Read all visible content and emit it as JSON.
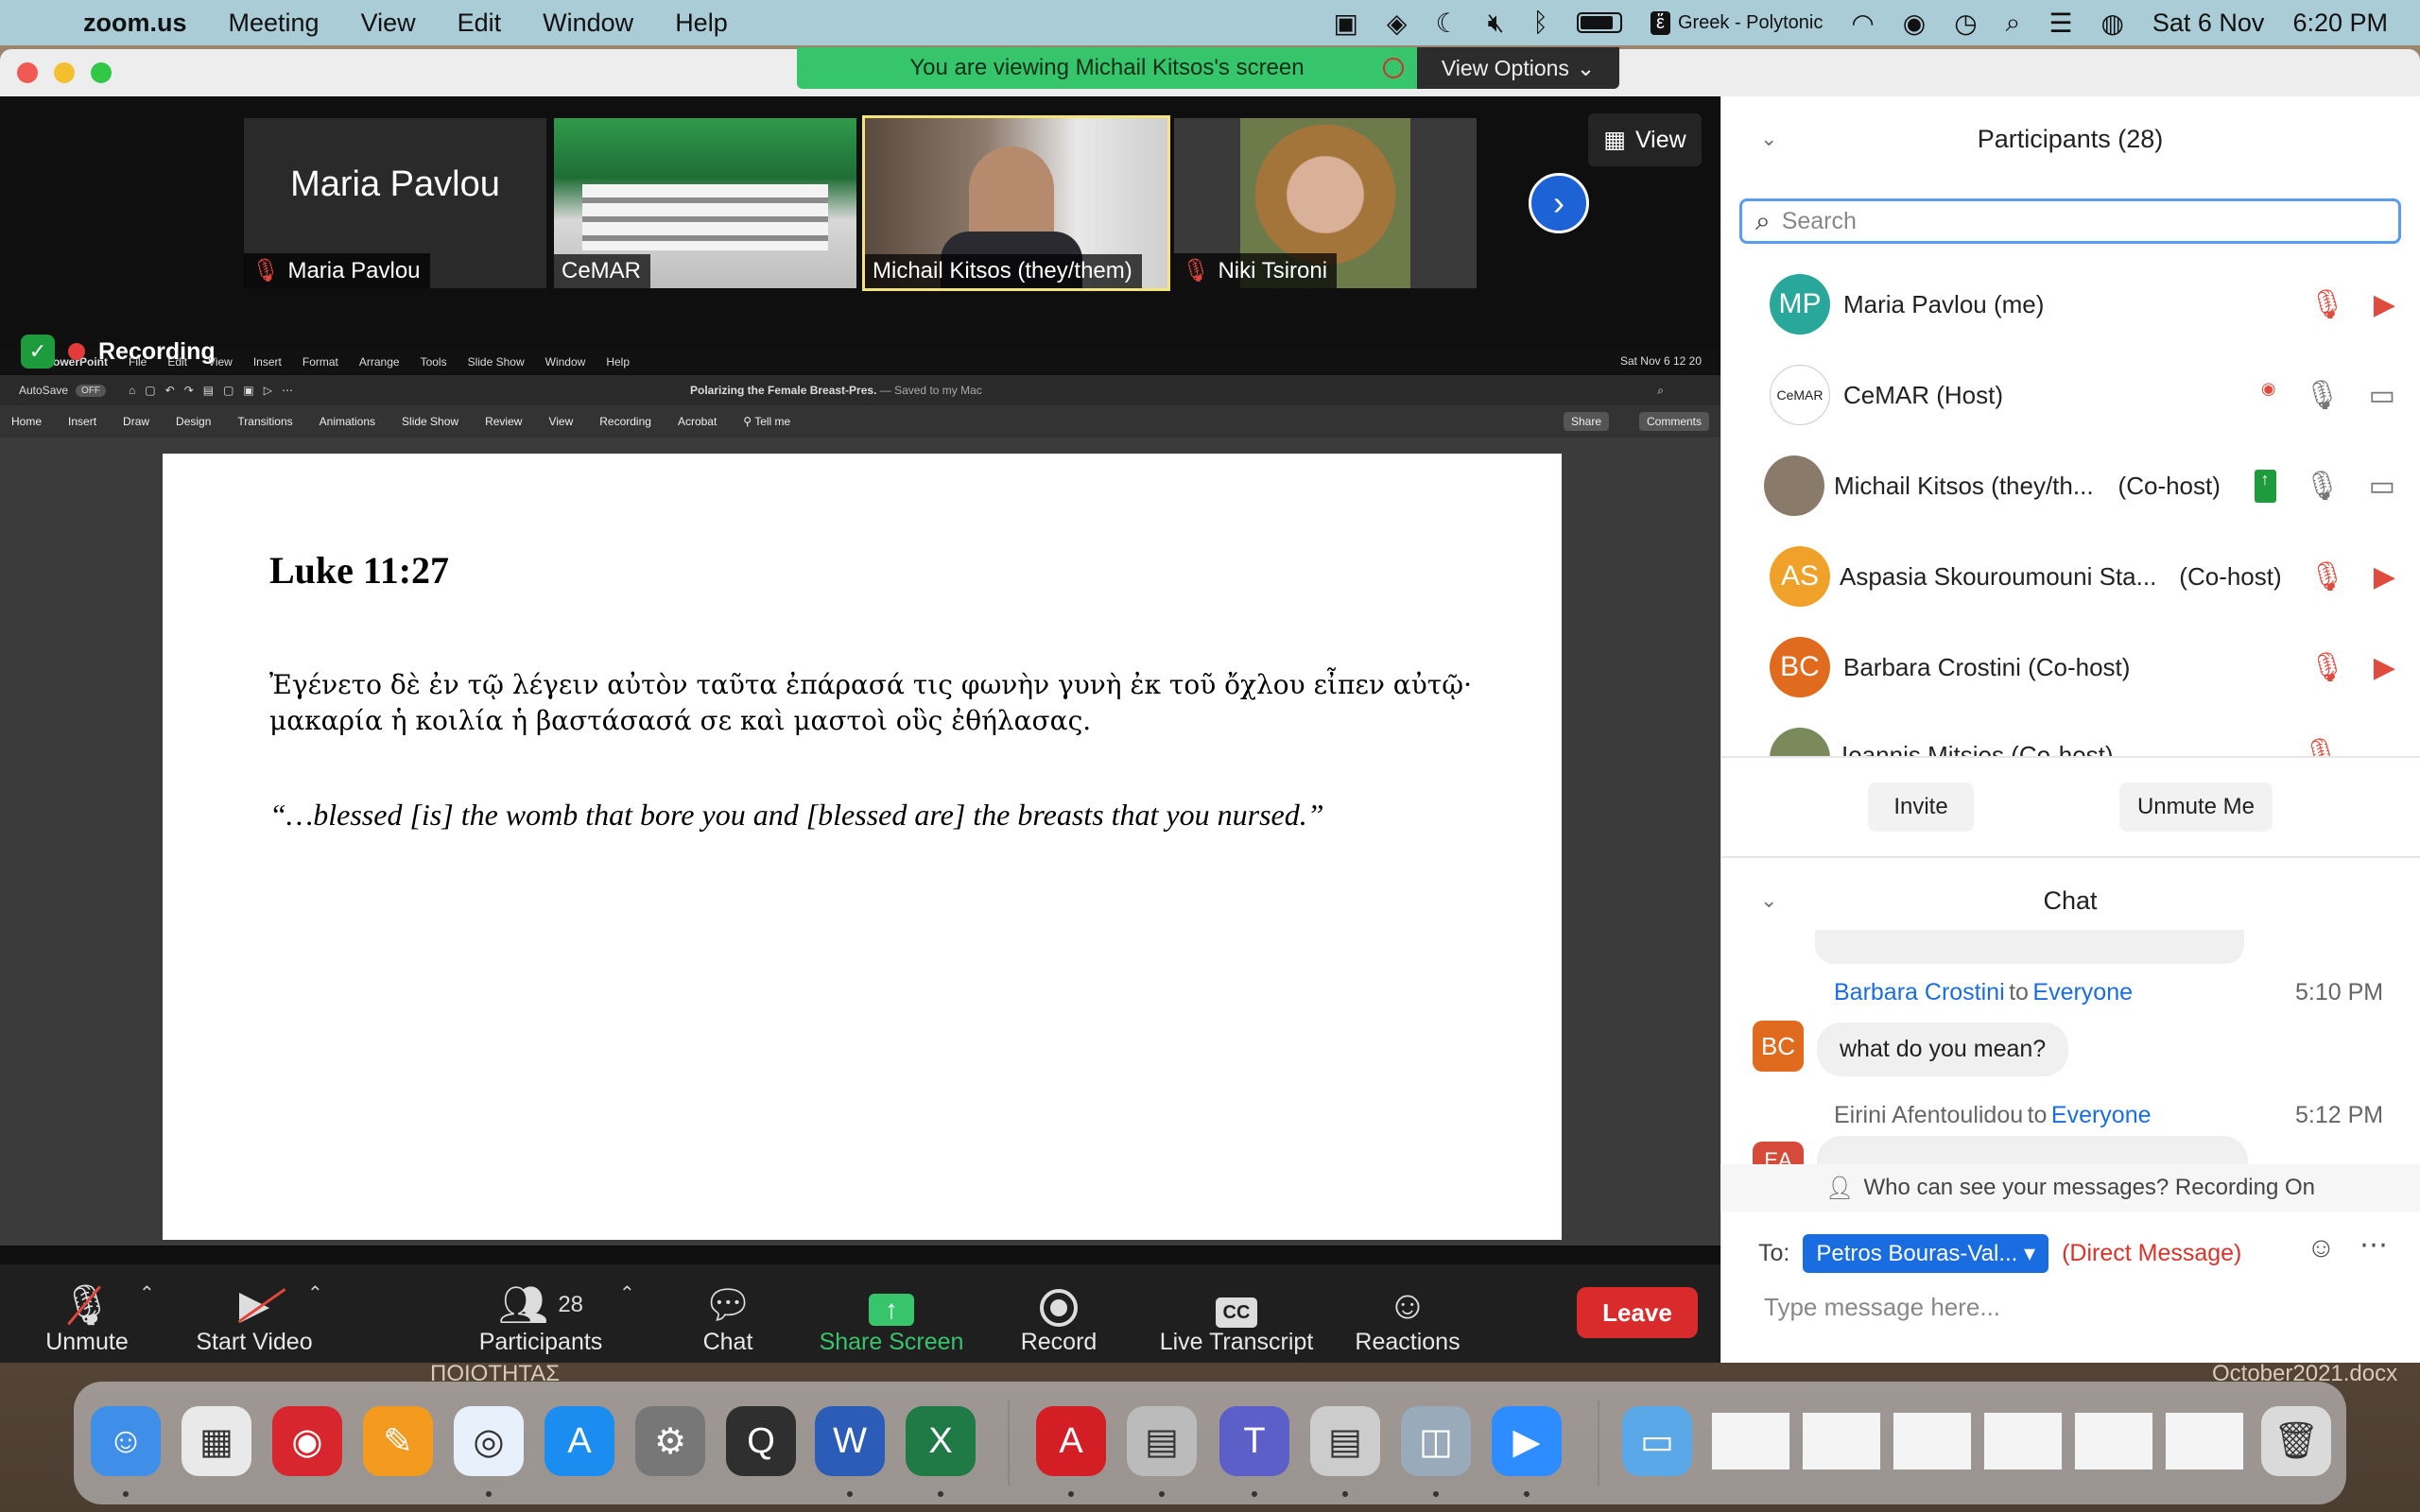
{
  "menubar": {
    "app": "zoom.us",
    "items": [
      "Meeting",
      "View",
      "Edit",
      "Window",
      "Help"
    ],
    "keyboard": "Greek - Polytonic",
    "date": "Sat 6 Nov",
    "time": "6:20 PM"
  },
  "banner": {
    "text": "You are viewing Michail Kitsos's screen",
    "view_options": "View Options"
  },
  "gallery": {
    "view_label": "View",
    "tiles": [
      {
        "label": "Maria Pavlou",
        "big_name": "Maria Pavlou",
        "muted": true
      },
      {
        "label": "CeMAR",
        "muted": false
      },
      {
        "label": "Michail Kitsos  (they/them)",
        "muted": false
      },
      {
        "label": "Niki Tsironi",
        "muted": true
      }
    ]
  },
  "recording_label": "Recording",
  "ppt": {
    "menubar": [
      "PowerPoint",
      "File",
      "Edit",
      "View",
      "Insert",
      "Format",
      "Arrange",
      "Tools",
      "Slide Show",
      "Window",
      "Help"
    ],
    "menubar_right": "Sat Nov 6  12 20",
    "autosave": "AutoSave",
    "autosave_state": "OFF",
    "title": "Polarizing the Female Breast-Pres.",
    "saved": "— Saved to my Mac",
    "ribbon": [
      "Home",
      "Insert",
      "Draw",
      "Design",
      "Transitions",
      "Animations",
      "Slide Show",
      "Review",
      "View",
      "Recording",
      "Acrobat",
      "Tell me"
    ],
    "share": "Share",
    "comments": "Comments"
  },
  "slide": {
    "title": "Luke 11:27",
    "greek": "Ἐγένετο δὲ ἐν τῷ λέγειν αὐτὸν ταῦτα ἐπάρασά τις φωνὴν γυνὴ ἐκ τοῦ ὄχλου εἶπεν αὐτῷ· μακαρία ἡ κοιλία ἡ βαστάσασά σε καὶ μαστοὶ οὓς ἐθήλασας.",
    "english": "“…blessed [is] the womb that bore you and [blessed are] the breasts that you nursed.”"
  },
  "toolbar": {
    "unmute": "Unmute",
    "start_video": "Start Video",
    "participants": "Participants",
    "participant_count": "28",
    "chat": "Chat",
    "share_screen": "Share Screen",
    "record": "Record",
    "live_transcript": "Live Transcript",
    "cc": "CC",
    "reactions": "Reactions",
    "leave": "Leave"
  },
  "participants": {
    "title": "Participants (28)",
    "search_placeholder": "Search",
    "list": [
      {
        "initials": "MP",
        "name": "Maria Pavlou (me)",
        "color": "#2aa79b"
      },
      {
        "initials": "",
        "name": "CeMAR (Host)",
        "color": "#ffffff"
      },
      {
        "initials": "",
        "name": "Michail Kitsos (they/th...",
        "role": "(Co-host)",
        "color": "#8a7a6a"
      },
      {
        "initials": "AS",
        "name": "Aspasia Skouroumouni Sta...",
        "role": "(Co-host)",
        "color": "#f0a12a"
      },
      {
        "initials": "BC",
        "name": "Barbara Crostini (Co-host)",
        "color": "#e06a1e"
      },
      {
        "initials": "",
        "name": "Ioannis Mitsios (Co-host)",
        "color": "#7a8a5a"
      }
    ],
    "invite": "Invite",
    "unmute_me": "Unmute Me"
  },
  "chat": {
    "title": "Chat",
    "messages": [
      {
        "initials": "BC",
        "from": "Barbara Crostini",
        "to_word": "to",
        "to": "Everyone",
        "time": "5:10 PM",
        "text": "what do you mean?",
        "color": "#e06a1e"
      },
      {
        "initials": "EA",
        "from": "Eirini Afentoulidou",
        "to_word": "to",
        "to": "Everyone",
        "time": "5:12 PM",
        "text": "",
        "color": "#d64a3a"
      }
    ],
    "who_can_see": "Who can see your messages? Recording On",
    "to_label": "To:",
    "recipient": "Petros Bouras-Val...",
    "direct": "(Direct Message)",
    "placeholder": "Type message here..."
  },
  "desktop": {
    "bg_text_left": "ΠΟΙΟΤΗΤΑΣ",
    "bg_text_right": "October2021.docx"
  },
  "dock_icons": [
    "finder-icon",
    "launchpad-icon",
    "photo-booth-icon",
    "pages-icon",
    "safari-icon",
    "app-store-icon",
    "system-preferences-icon",
    "quicktime-icon",
    "word-icon",
    "excel-icon",
    "acrobat-icon",
    "printer-icon",
    "teams-icon",
    "printer2-icon",
    "preview-icon",
    "zoom-icon",
    "folder-icon",
    "trash-icon"
  ]
}
